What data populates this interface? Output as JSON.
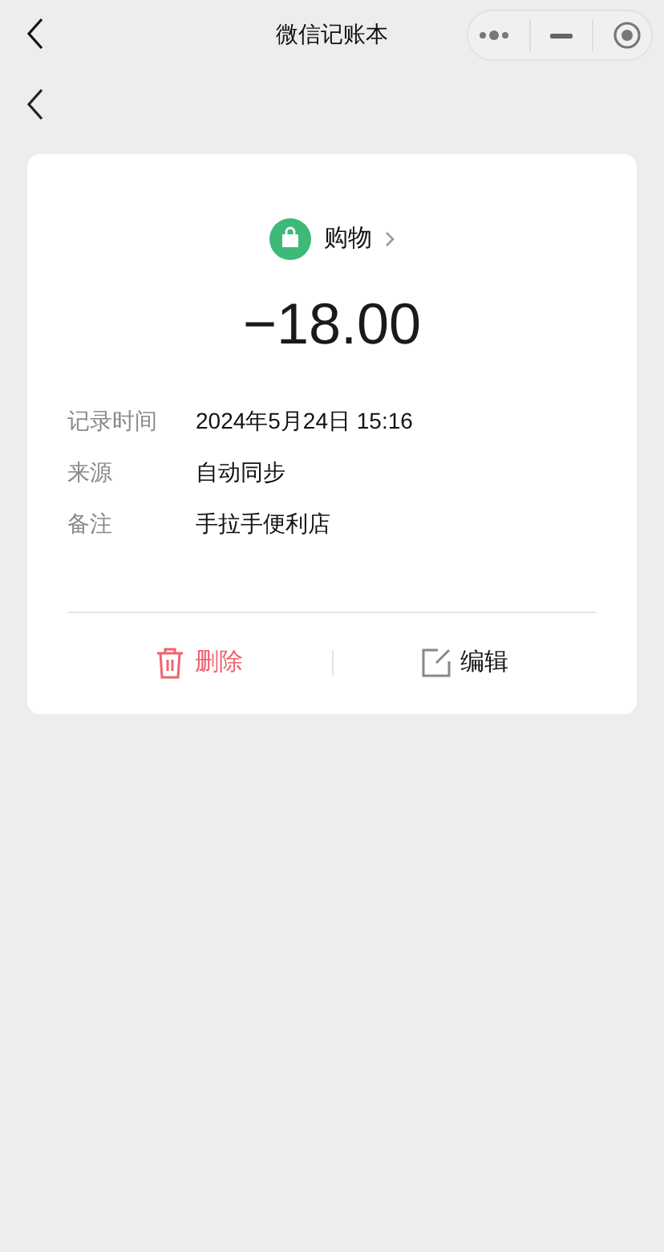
{
  "nav_bar": {
    "title": "微信记账本"
  },
  "category": {
    "name": "购物",
    "color": "#3db978"
  },
  "amount": "−18.00",
  "details": [
    {
      "label": "记录时间",
      "value": "2024年5月24日 15:16"
    },
    {
      "label": "来源",
      "value": "自动同步"
    },
    {
      "label": "备注",
      "value": "手拉手便利店"
    }
  ],
  "actions": [
    {
      "kind": "delete",
      "label": "删除"
    },
    {
      "kind": "edit",
      "label": "编辑"
    }
  ]
}
